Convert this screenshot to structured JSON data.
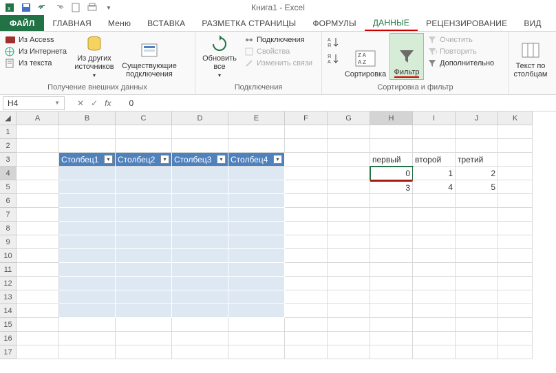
{
  "title": "Книга1 - Excel",
  "tabs": {
    "file": "ФАЙЛ",
    "items": [
      "ГЛАВНАЯ",
      "Меню",
      "ВСТАВКА",
      "РАЗМЕТКА СТРАНИЦЫ",
      "ФОРМУЛЫ",
      "ДАННЫЕ",
      "РЕЦЕНЗИРОВАНИЕ",
      "ВИД"
    ],
    "active": "ДАННЫЕ"
  },
  "ribbon": {
    "group1": {
      "label": "Получение внешних данных",
      "access": "Из Access",
      "web": "Из Интернета",
      "text": "Из текста",
      "other": "Из других источников",
      "existing": "Существующие подключения"
    },
    "group2": {
      "label": "Подключения",
      "refresh": "Обновить все",
      "conns": "Подключения",
      "props": "Свойства",
      "edit": "Изменить связи"
    },
    "group3": {
      "label": "Сортировка и фильтр",
      "sort": "Сортировка",
      "filter": "Фильтр",
      "clear": "Очистить",
      "reapply": "Повторить",
      "advanced": "Дополнительно"
    },
    "group4": {
      "textcols": "Текст по столбцам"
    }
  },
  "namebox": "H4",
  "formula_value": "0",
  "columns": [
    "A",
    "B",
    "C",
    "D",
    "E",
    "F",
    "G",
    "H",
    "I",
    "J",
    "K"
  ],
  "rows": [
    "1",
    "2",
    "3",
    "4",
    "5",
    "6",
    "7",
    "8",
    "9",
    "10",
    "11",
    "12",
    "13",
    "14",
    "15",
    "16",
    "17"
  ],
  "active_row": "4",
  "active_col": "H",
  "table_headers": [
    "Столбец1",
    "Столбец2",
    "Столбец3",
    "Столбец4"
  ],
  "side_headers": [
    "первый",
    "второй",
    "третий"
  ],
  "side_r1": [
    "0",
    "1",
    "2"
  ],
  "side_r2": [
    "3",
    "4",
    "5"
  ]
}
